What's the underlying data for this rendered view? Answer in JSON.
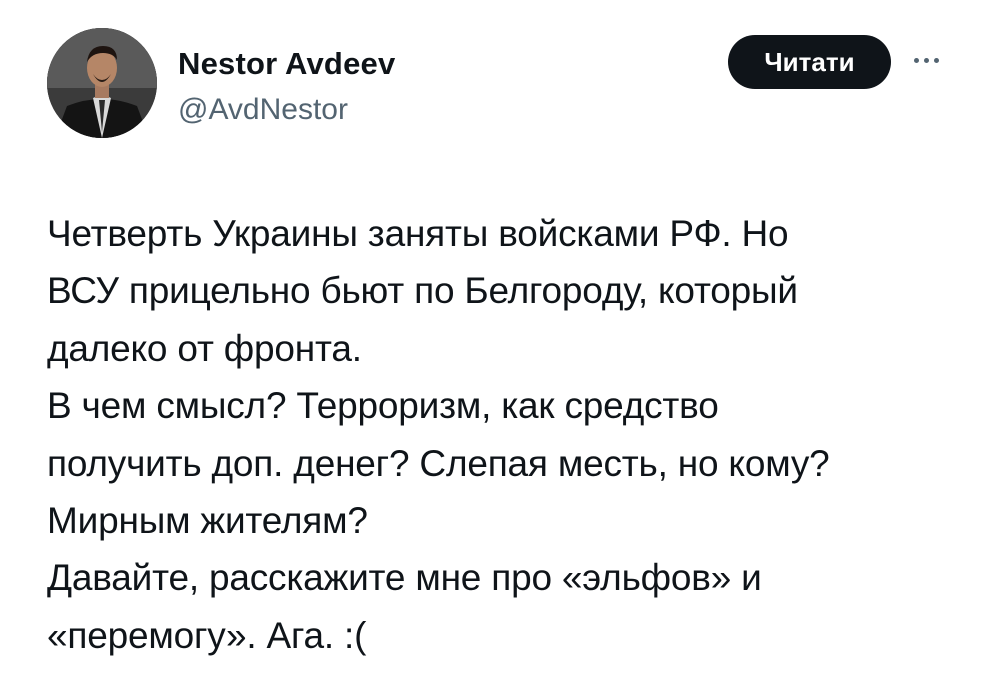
{
  "author": {
    "display_name": "Nestor Avdeev",
    "handle": "@AvdNestor",
    "avatar_icon": "avatar-photo"
  },
  "actions": {
    "follow_label": "Читати",
    "more_icon": "more-options-icon"
  },
  "tweet": {
    "lines": [
      "Четверть Украины заняты войсками РФ. Но",
      "ВСУ прицельно бьют по Белгороду, который",
      "далеко от фронта.",
      "В чем смысл? Терроризм, как средство",
      "получить доп. денег? Слепая месть, но кому?",
      "Мирным жителям?",
      "Давайте, расскажите мне про «эльфов» и",
      "«перемогу». Ага. :("
    ]
  },
  "colors": {
    "text": "#0f1419",
    "secondary": "#536471",
    "button_bg": "#0f1419",
    "button_text": "#ffffff"
  }
}
